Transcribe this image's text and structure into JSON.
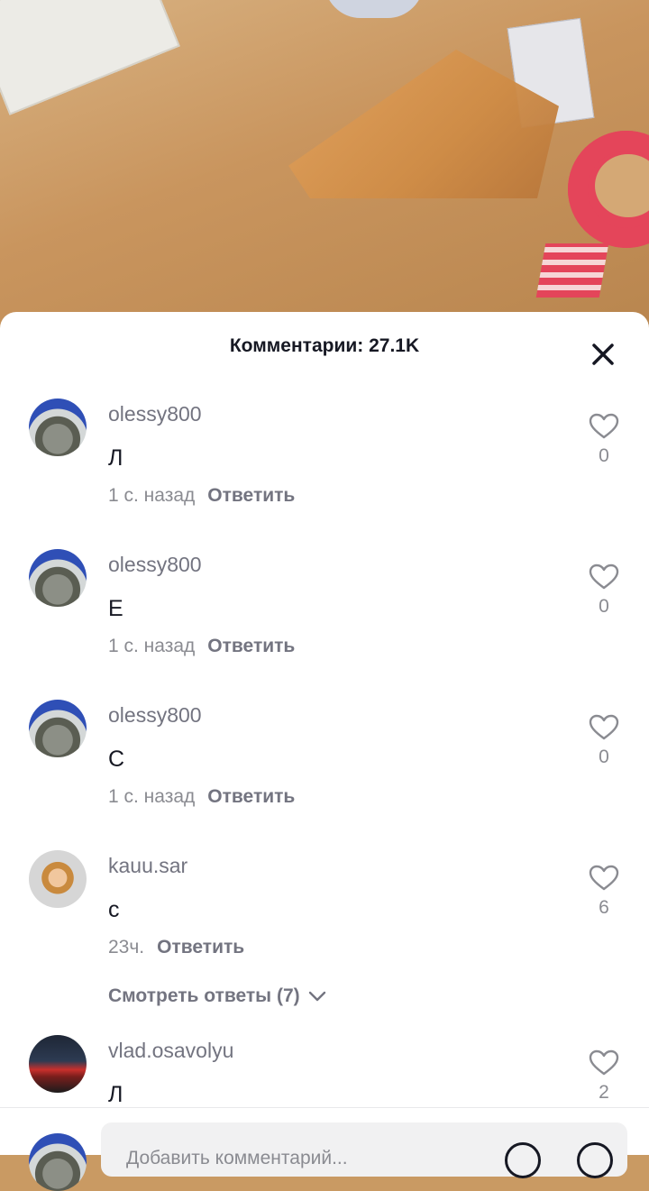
{
  "header": {
    "title": "Комментарии: 27.1K"
  },
  "comments": [
    {
      "username": "olessy800",
      "text": "Л",
      "time": "1 с. назад",
      "reply_label": "Ответить",
      "likes": "0",
      "avatar": "blue-cap-cat"
    },
    {
      "username": "olessy800",
      "text": "Е",
      "time": "1 с. назад",
      "reply_label": "Ответить",
      "likes": "0",
      "avatar": "blue-cap-cat"
    },
    {
      "username": "olessy800",
      "text": "С",
      "time": "1 с. назад",
      "reply_label": "Ответить",
      "likes": "0",
      "avatar": "blue-cap-cat"
    },
    {
      "username": "kauu.sar",
      "text": "с",
      "time": "23ч.",
      "reply_label": "Ответить",
      "likes": "6",
      "avatar": "girl-emoji",
      "view_replies": "Смотреть ответы (7)"
    },
    {
      "username": "vlad.osavolyu",
      "text": "Л",
      "likes": "2",
      "avatar": "red-car"
    }
  ],
  "input": {
    "placeholder": "Добавить комментарий..."
  },
  "icons": {
    "close": "close-icon",
    "like": "heart-icon",
    "expand": "chevron-down-icon",
    "mention": "at-icon",
    "emoji": "emoji-icon"
  },
  "colors": {
    "text_primary": "#161823",
    "text_secondary": "#737480",
    "sheet_bg": "#ffffff"
  }
}
